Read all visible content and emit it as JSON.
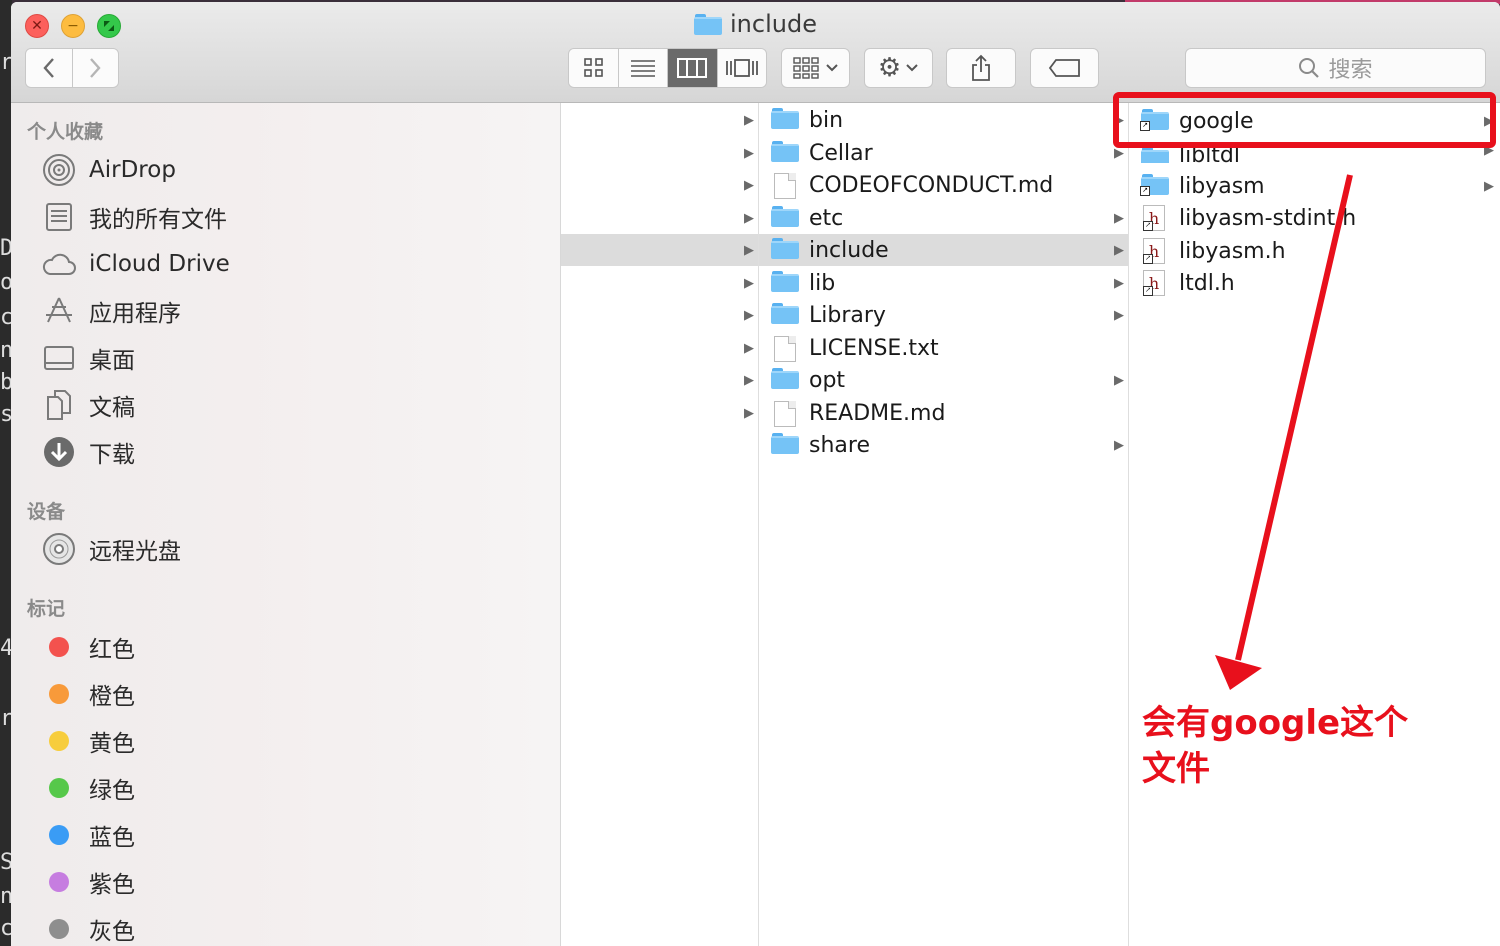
{
  "window": {
    "title": "include"
  },
  "toolbar": {
    "back_icon": "chevron-left",
    "forward_icon": "chevron-right",
    "view_modes": [
      "icon-view",
      "list-view",
      "column-view",
      "cover-flow-view"
    ],
    "active_view": "column-view",
    "search_placeholder": "搜索"
  },
  "sidebar": {
    "favorites_heading": "个人收藏",
    "favorites": [
      {
        "label": "AirDrop",
        "icon": "airdrop-icon"
      },
      {
        "label": "我的所有文件",
        "icon": "all-files-icon"
      },
      {
        "label": "iCloud Drive",
        "icon": "cloud-icon"
      },
      {
        "label": "应用程序",
        "icon": "applications-icon"
      },
      {
        "label": "桌面",
        "icon": "desktop-icon"
      },
      {
        "label": "文稿",
        "icon": "documents-icon"
      },
      {
        "label": "下载",
        "icon": "download-icon"
      }
    ],
    "devices_heading": "设备",
    "devices": [
      {
        "label": "远程光盘",
        "icon": "disc-icon"
      }
    ],
    "tags_heading": "标记",
    "tags": [
      {
        "label": "红色",
        "color": "#f3524e"
      },
      {
        "label": "橙色",
        "color": "#f89a3a"
      },
      {
        "label": "黄色",
        "color": "#f7cd3c"
      },
      {
        "label": "绿色",
        "color": "#56c84a"
      },
      {
        "label": "蓝色",
        "color": "#3a9cf5"
      },
      {
        "label": "紫色",
        "color": "#c67de0"
      },
      {
        "label": "灰色",
        "color": "#8e8e8e"
      }
    ]
  },
  "column2": {
    "items": [
      {
        "name": "bin",
        "type": "folder",
        "arrow": true
      },
      {
        "name": "Cellar",
        "type": "folder",
        "arrow": true
      },
      {
        "name": "CODEOFCONDUCT.md",
        "type": "file",
        "arrow": false
      },
      {
        "name": "etc",
        "type": "folder",
        "arrow": true
      },
      {
        "name": "include",
        "type": "folder",
        "arrow": true,
        "selected": true
      },
      {
        "name": "lib",
        "type": "folder",
        "arrow": true
      },
      {
        "name": "Library",
        "type": "folder",
        "arrow": true
      },
      {
        "name": "LICENSE.txt",
        "type": "file",
        "arrow": false
      },
      {
        "name": "opt",
        "type": "folder",
        "arrow": true
      },
      {
        "name": "README.md",
        "type": "file",
        "arrow": false
      },
      {
        "name": "share",
        "type": "folder",
        "arrow": true
      }
    ]
  },
  "column3": {
    "items": [
      {
        "name": "google",
        "type": "folder-alias",
        "arrow": true
      },
      {
        "name": "libltdl",
        "type": "folder-alias",
        "arrow": true
      },
      {
        "name": "libyasm",
        "type": "folder-alias",
        "arrow": true
      },
      {
        "name": "libyasm-stdint.h",
        "type": "header-alias",
        "arrow": false
      },
      {
        "name": "libyasm.h",
        "type": "header-alias",
        "arrow": false
      },
      {
        "name": "ltdl.h",
        "type": "header-alias",
        "arrow": false
      }
    ]
  },
  "annotation": {
    "line1": "会有google这个",
    "line2": "文件",
    "color": "#e8101c"
  },
  "background_fragments": [
    "r/",
    "D",
    "oi",
    "cc",
    "n",
    "b",
    "sh",
    "4",
    "r/",
    "S",
    "n",
    "c"
  ]
}
